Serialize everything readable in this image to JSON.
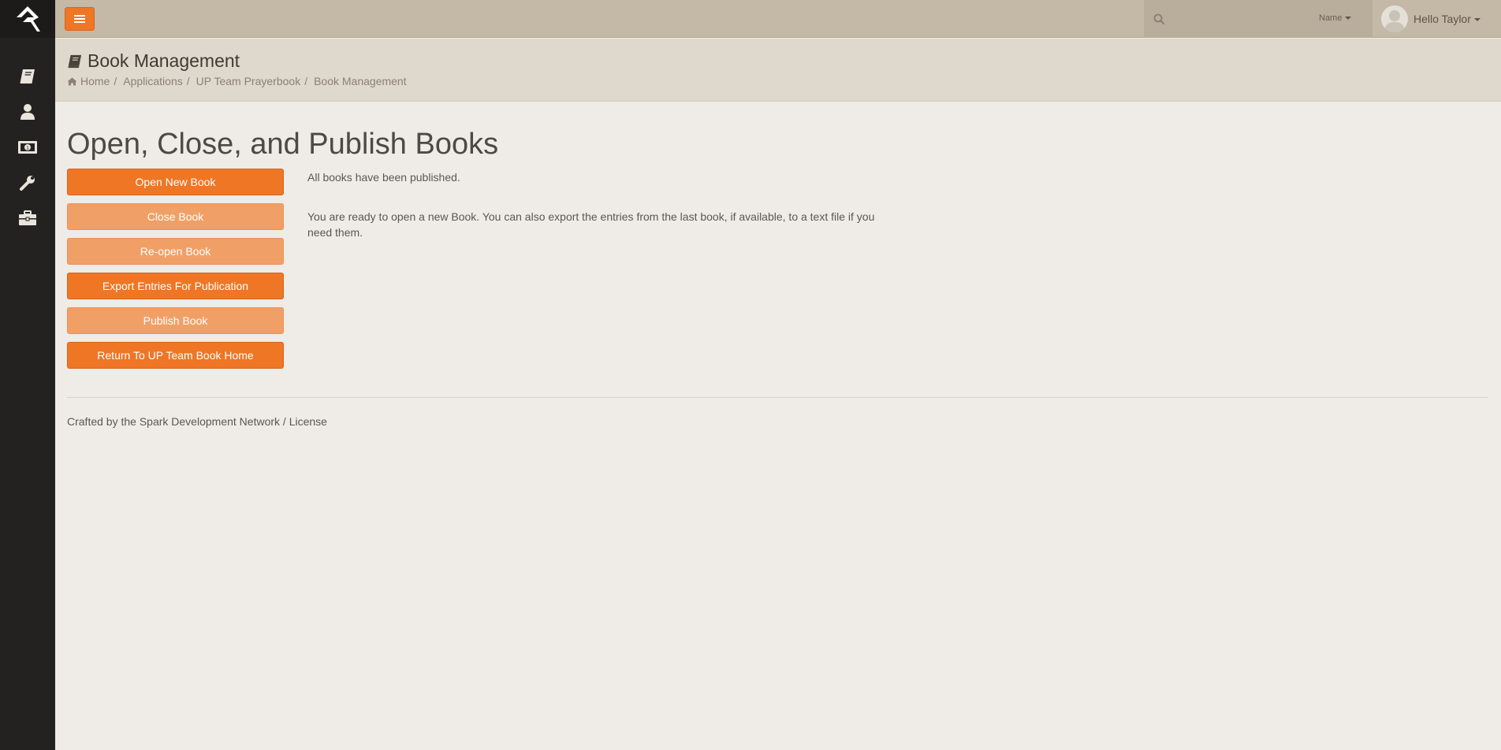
{
  "header": {
    "search_filter_label": "Name",
    "user_greeting": "Hello Taylor"
  },
  "sidebar": {
    "items": [
      {
        "icon": "book-icon"
      },
      {
        "icon": "user-icon"
      },
      {
        "icon": "money-icon"
      },
      {
        "icon": "wrench-icon"
      },
      {
        "icon": "briefcase-icon"
      }
    ]
  },
  "page_header": {
    "title": "Book Management",
    "breadcrumb": [
      "Home",
      "Applications",
      "UP Team Prayerbook",
      "Book Management"
    ]
  },
  "main": {
    "heading": "Open, Close, and Publish Books",
    "buttons": [
      {
        "label": "Open New Book",
        "enabled": true
      },
      {
        "label": "Close Book",
        "enabled": false
      },
      {
        "label": "Re-open Book",
        "enabled": false
      },
      {
        "label": "Export Entries For Publication",
        "enabled": true
      },
      {
        "label": "Publish Book",
        "enabled": false
      },
      {
        "label": "Return To UP Team Book Home",
        "enabled": true
      }
    ],
    "status_message": "All books have been published.",
    "info_message": "You are ready to open a new Book. You can also export the entries from the last book, if available, to a text file if you need them."
  },
  "footer": {
    "text_prefix": "Crafted by the ",
    "org_link": "Spark Development Network",
    "separator": " / ",
    "license_link": "License"
  },
  "colors": {
    "accent": "#ee7625",
    "accent_disabled": "#f0a067",
    "sidebar_bg": "#232221",
    "topbar_bg": "#c4b8a6",
    "page_bg": "#efebe6"
  }
}
